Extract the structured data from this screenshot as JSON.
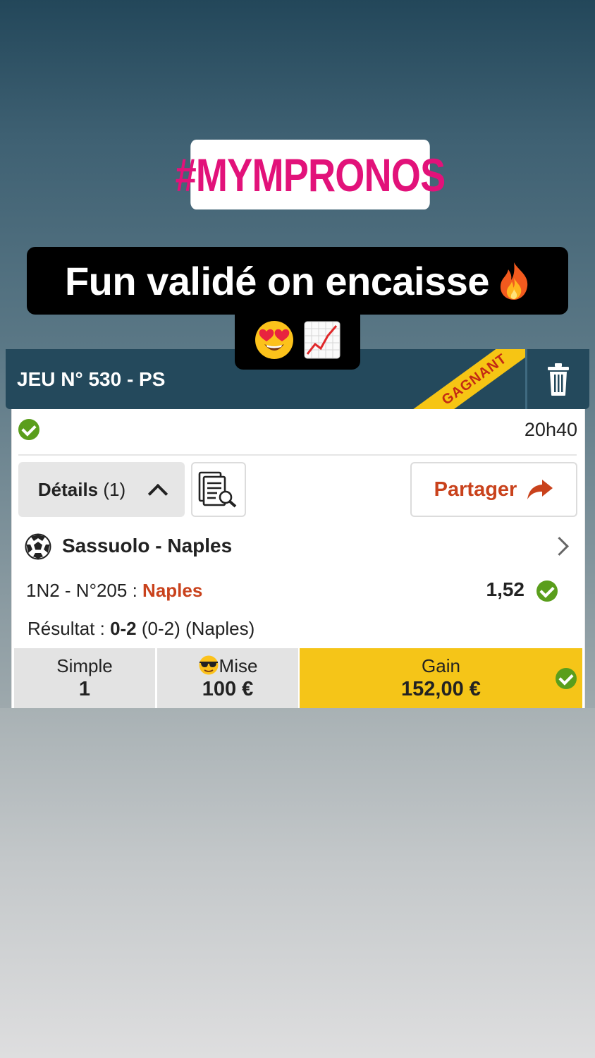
{
  "story": {
    "hashtag": "#MYMPRONOS",
    "caption_line1": "Fun validé on encaisse",
    "emojis": [
      "fire",
      "heart-eyes",
      "chart-increasing"
    ]
  },
  "card": {
    "title": "JEU N° 530 - PS",
    "ribbon": "GAGNANT",
    "time": "20h40",
    "details_label": "Détails",
    "details_count": "(1)",
    "share_label": "Partager",
    "match": "Sassuolo - Naples",
    "bet_market": "1N2 - N°205 :",
    "bet_pick": "Naples",
    "odds": "1,52",
    "result_prefix": "Résultat :",
    "result_score": "0-2",
    "result_detail": "(0-2) (Naples)",
    "footer": {
      "type_label": "Simple",
      "type_value": "1",
      "stake_label": "Mise",
      "stake_value": "100 €",
      "gain_label": "Gain",
      "gain_value": "152,00 €"
    }
  },
  "colors": {
    "header_bg": "#24495c",
    "ribbon": "#f6c514",
    "accent_orange": "#c9421c",
    "check_green": "#5a9e1c",
    "gain_bg": "#f5c518",
    "hashtag_pink": "#e2127a"
  }
}
